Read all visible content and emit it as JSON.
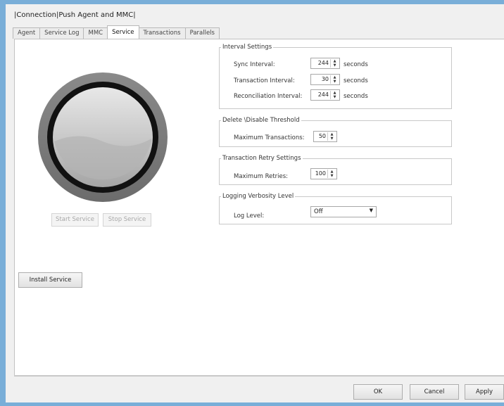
{
  "window": {
    "title": "|Connection|Push Agent and MMC|"
  },
  "tabs": [
    {
      "label": "Agent"
    },
    {
      "label": "Service Log"
    },
    {
      "label": "MMC"
    },
    {
      "label": "Service"
    },
    {
      "label": "Transactions"
    },
    {
      "label": "Parallels"
    }
  ],
  "active_tab": "Service",
  "service_panel": {
    "start_label": "Start Service",
    "stop_label": "Stop Service",
    "install_label": "Install Service"
  },
  "interval_settings": {
    "title": "Interval Settings",
    "sync_label": "Sync Interval:",
    "sync_value": "244",
    "transaction_label": "Transaction Interval:",
    "transaction_value": "30",
    "reconciliation_label": "Reconciliation Interval:",
    "reconciliation_value": "244",
    "unit": "seconds"
  },
  "delete_threshold": {
    "title": "Delete \\Disable Threshold",
    "label": "Maximum Transactions:",
    "value": "50"
  },
  "retry_settings": {
    "title": "Transaction Retry Settings",
    "label": "Maximum Retries:",
    "value": "100"
  },
  "logging": {
    "title": "Logging Verbosity Level",
    "label": "Log Level:",
    "value": "Off"
  },
  "footer": {
    "ok_label": "OK",
    "cancel_label": "Cancel",
    "apply_label": "Apply"
  }
}
